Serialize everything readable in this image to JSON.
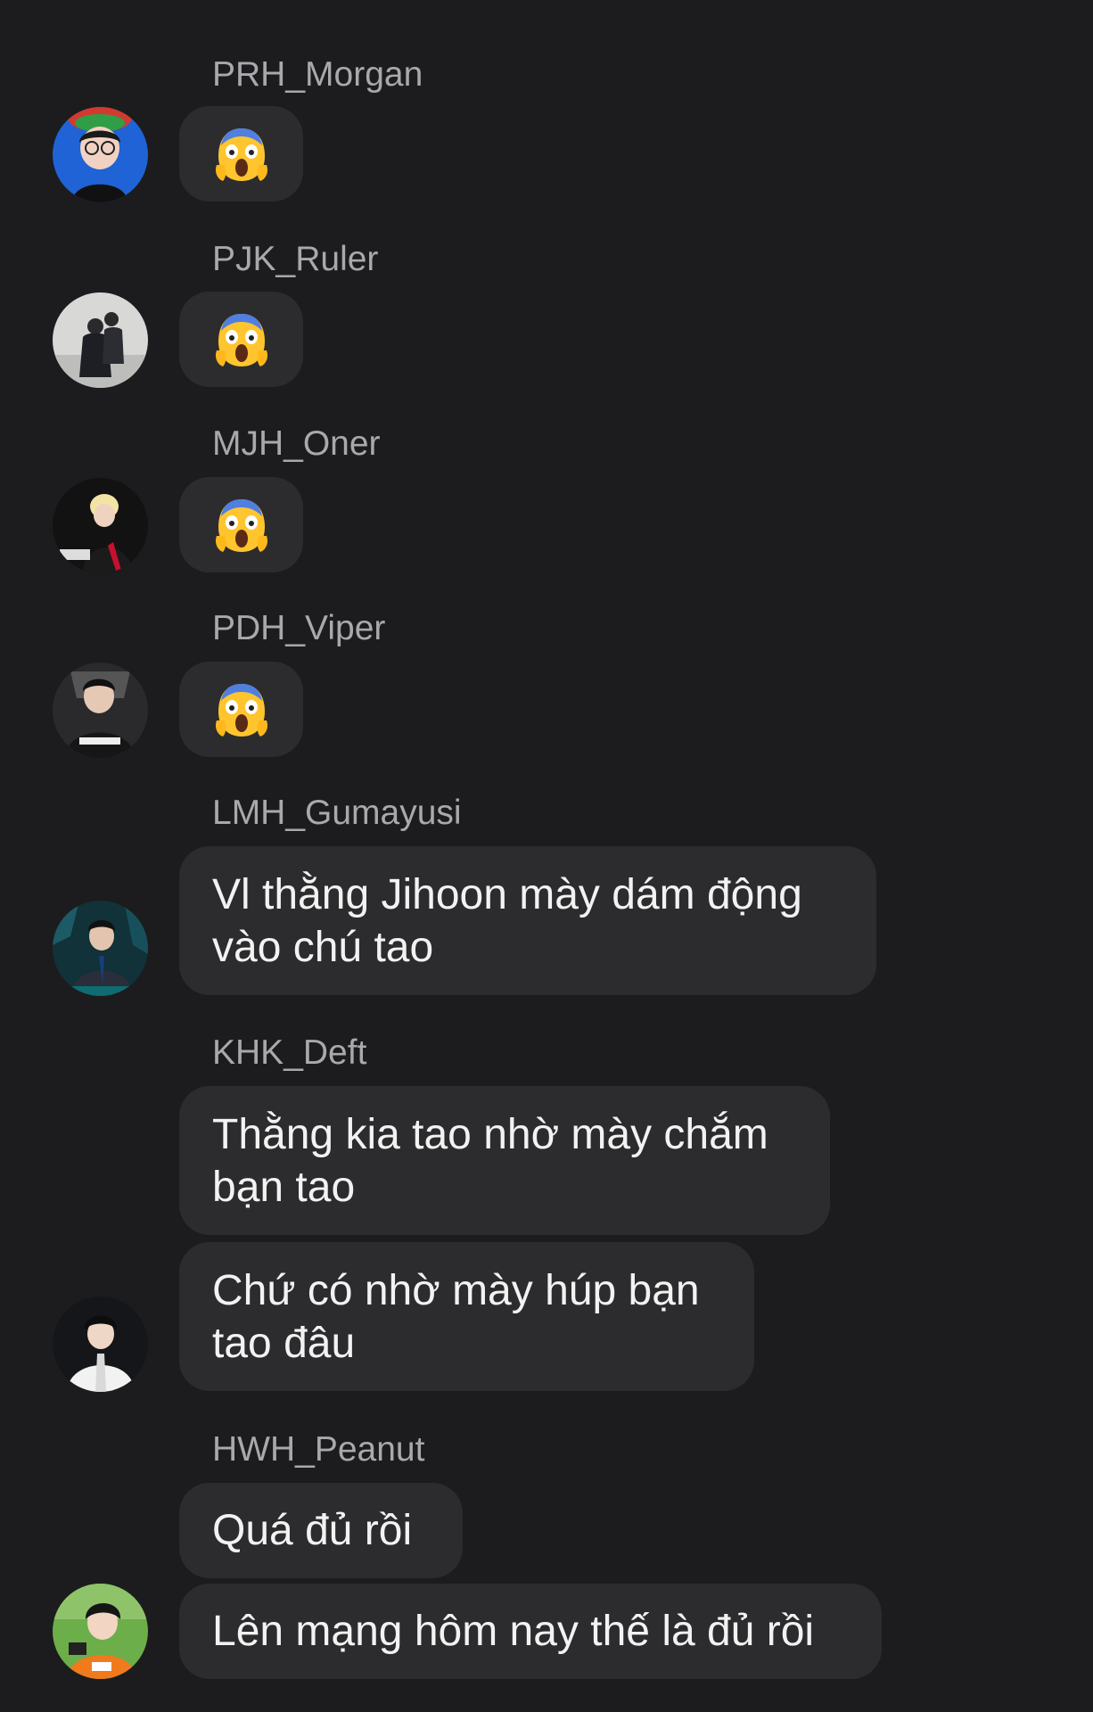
{
  "conversation": {
    "messages": [
      {
        "sender": "PRH_Morgan",
        "emoji": "😱",
        "avatar": "avatar-prh-morgan"
      },
      {
        "sender": "PJK_Ruler",
        "emoji": "😱",
        "avatar": "avatar-pjk-ruler"
      },
      {
        "sender": "MJH_Oner",
        "emoji": "😱",
        "avatar": "avatar-mjh-oner"
      },
      {
        "sender": "PDH_Viper",
        "emoji": "😱",
        "avatar": "avatar-pdh-viper"
      },
      {
        "sender": "LMH_Gumayusi",
        "lines": [
          "Vl thằng Jihoon mày dám động",
          "vào chú tao"
        ],
        "avatar": "avatar-lmh-gumayusi"
      },
      {
        "sender": "KHK_Deft",
        "lines": [
          "Thằng kia tao nhờ mày chắm",
          "bạn tao"
        ]
      },
      {
        "lines": [
          "Chứ có nhờ mày húp bạn",
          "tao đâu"
        ],
        "avatar": "avatar-khk-deft"
      },
      {
        "sender": "HWH_Peanut",
        "lines": [
          "Quá đủ rồi"
        ]
      },
      {
        "lines": [
          "Lên mạng hôm nay thế là đủ rồi"
        ],
        "avatar": "avatar-hwh-peanut"
      }
    ]
  },
  "theme": {
    "background": "#1c1c1e",
    "bubble": "#2c2c2e",
    "sender_name": "#a8a8ad",
    "text": "#f2f2f2"
  }
}
